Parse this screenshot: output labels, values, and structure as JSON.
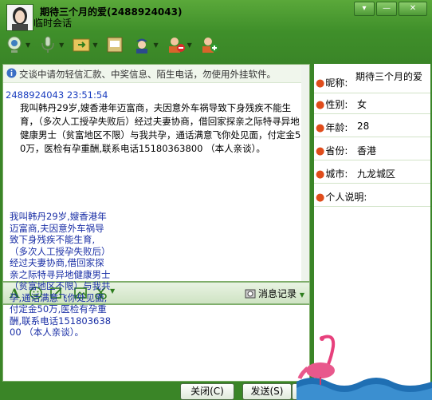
{
  "window": {
    "title": "期待三个月的爱(2488924043)",
    "subtitle": "临时会话",
    "controls": [
      "▾",
      "—",
      "✕"
    ]
  },
  "toolbar": {
    "items": [
      "video-icon",
      "voice-icon",
      "file-transfer-icon",
      "message-icon",
      "police-icon",
      "remove-contact-icon",
      "add-contact-icon"
    ]
  },
  "chat": {
    "notice": "交谈中请勿轻信汇款、中奖信息、陌生电话，勿使用外挂软件。",
    "messages": [
      {
        "sender_time": "2488924043  23:51:54",
        "text": "我叫韩丹29岁,嫂香港年迈富商，夫因意外车祸导致下身残疾不能生育，（多次人工授孕失败后）经过夫妻协商，借回家探亲之际特寻异地健康男士（贫富地区不限）与我共孕，通话满意飞你处见面，付定金50万，医检有孕重酬,联系电话15180363800 （本人亲谈）。"
      }
    ]
  },
  "input_toolbar": {
    "history_label": "消息记录"
  },
  "buttons": {
    "close": "关闭(C)",
    "send": "发送(S)"
  },
  "profile": {
    "nickname_label": "昵称:",
    "nickname": "期待三个月的爱",
    "gender_label": "性别:",
    "gender": "女",
    "age_label": "年龄:",
    "age": "28",
    "province_label": "省份:",
    "province": "香港",
    "city_label": "城市:",
    "city": "九龙城区",
    "bio_label": "个人说明:",
    "bio": "我叫韩丹29岁,嫂香港年迈富商,夫因意外车祸导致下身残疾不能生育,（多次人工授孕失败后）经过夫妻协商,借回家探亲之际特寻异地健康男士（贫富地区不限）与我共孕,通话满意飞你处见面,付定金50万,医检有孕重酬,联系电话15180363800 （本人亲谈）。"
  }
}
